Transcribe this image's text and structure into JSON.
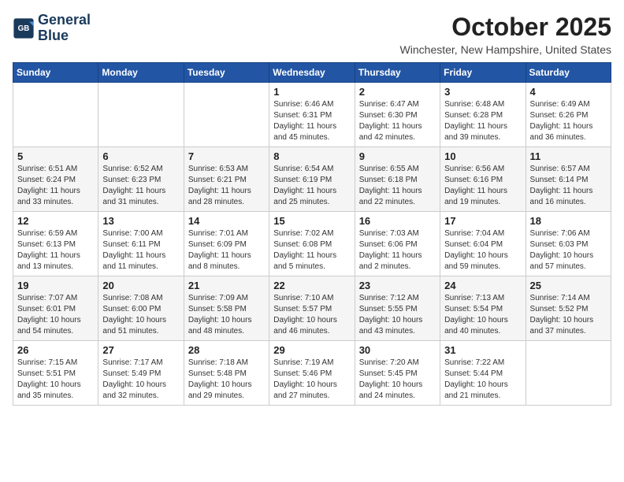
{
  "header": {
    "logo_line1": "General",
    "logo_line2": "Blue",
    "month_title": "October 2025",
    "location": "Winchester, New Hampshire, United States"
  },
  "days_of_week": [
    "Sunday",
    "Monday",
    "Tuesday",
    "Wednesday",
    "Thursday",
    "Friday",
    "Saturday"
  ],
  "weeks": [
    [
      {
        "day": "",
        "info": ""
      },
      {
        "day": "",
        "info": ""
      },
      {
        "day": "",
        "info": ""
      },
      {
        "day": "1",
        "info": "Sunrise: 6:46 AM\nSunset: 6:31 PM\nDaylight: 11 hours and 45 minutes."
      },
      {
        "day": "2",
        "info": "Sunrise: 6:47 AM\nSunset: 6:30 PM\nDaylight: 11 hours and 42 minutes."
      },
      {
        "day": "3",
        "info": "Sunrise: 6:48 AM\nSunset: 6:28 PM\nDaylight: 11 hours and 39 minutes."
      },
      {
        "day": "4",
        "info": "Sunrise: 6:49 AM\nSunset: 6:26 PM\nDaylight: 11 hours and 36 minutes."
      }
    ],
    [
      {
        "day": "5",
        "info": "Sunrise: 6:51 AM\nSunset: 6:24 PM\nDaylight: 11 hours and 33 minutes."
      },
      {
        "day": "6",
        "info": "Sunrise: 6:52 AM\nSunset: 6:23 PM\nDaylight: 11 hours and 31 minutes."
      },
      {
        "day": "7",
        "info": "Sunrise: 6:53 AM\nSunset: 6:21 PM\nDaylight: 11 hours and 28 minutes."
      },
      {
        "day": "8",
        "info": "Sunrise: 6:54 AM\nSunset: 6:19 PM\nDaylight: 11 hours and 25 minutes."
      },
      {
        "day": "9",
        "info": "Sunrise: 6:55 AM\nSunset: 6:18 PM\nDaylight: 11 hours and 22 minutes."
      },
      {
        "day": "10",
        "info": "Sunrise: 6:56 AM\nSunset: 6:16 PM\nDaylight: 11 hours and 19 minutes."
      },
      {
        "day": "11",
        "info": "Sunrise: 6:57 AM\nSunset: 6:14 PM\nDaylight: 11 hours and 16 minutes."
      }
    ],
    [
      {
        "day": "12",
        "info": "Sunrise: 6:59 AM\nSunset: 6:13 PM\nDaylight: 11 hours and 13 minutes."
      },
      {
        "day": "13",
        "info": "Sunrise: 7:00 AM\nSunset: 6:11 PM\nDaylight: 11 hours and 11 minutes."
      },
      {
        "day": "14",
        "info": "Sunrise: 7:01 AM\nSunset: 6:09 PM\nDaylight: 11 hours and 8 minutes."
      },
      {
        "day": "15",
        "info": "Sunrise: 7:02 AM\nSunset: 6:08 PM\nDaylight: 11 hours and 5 minutes."
      },
      {
        "day": "16",
        "info": "Sunrise: 7:03 AM\nSunset: 6:06 PM\nDaylight: 11 hours and 2 minutes."
      },
      {
        "day": "17",
        "info": "Sunrise: 7:04 AM\nSunset: 6:04 PM\nDaylight: 10 hours and 59 minutes."
      },
      {
        "day": "18",
        "info": "Sunrise: 7:06 AM\nSunset: 6:03 PM\nDaylight: 10 hours and 57 minutes."
      }
    ],
    [
      {
        "day": "19",
        "info": "Sunrise: 7:07 AM\nSunset: 6:01 PM\nDaylight: 10 hours and 54 minutes."
      },
      {
        "day": "20",
        "info": "Sunrise: 7:08 AM\nSunset: 6:00 PM\nDaylight: 10 hours and 51 minutes."
      },
      {
        "day": "21",
        "info": "Sunrise: 7:09 AM\nSunset: 5:58 PM\nDaylight: 10 hours and 48 minutes."
      },
      {
        "day": "22",
        "info": "Sunrise: 7:10 AM\nSunset: 5:57 PM\nDaylight: 10 hours and 46 minutes."
      },
      {
        "day": "23",
        "info": "Sunrise: 7:12 AM\nSunset: 5:55 PM\nDaylight: 10 hours and 43 minutes."
      },
      {
        "day": "24",
        "info": "Sunrise: 7:13 AM\nSunset: 5:54 PM\nDaylight: 10 hours and 40 minutes."
      },
      {
        "day": "25",
        "info": "Sunrise: 7:14 AM\nSunset: 5:52 PM\nDaylight: 10 hours and 37 minutes."
      }
    ],
    [
      {
        "day": "26",
        "info": "Sunrise: 7:15 AM\nSunset: 5:51 PM\nDaylight: 10 hours and 35 minutes."
      },
      {
        "day": "27",
        "info": "Sunrise: 7:17 AM\nSunset: 5:49 PM\nDaylight: 10 hours and 32 minutes."
      },
      {
        "day": "28",
        "info": "Sunrise: 7:18 AM\nSunset: 5:48 PM\nDaylight: 10 hours and 29 minutes."
      },
      {
        "day": "29",
        "info": "Sunrise: 7:19 AM\nSunset: 5:46 PM\nDaylight: 10 hours and 27 minutes."
      },
      {
        "day": "30",
        "info": "Sunrise: 7:20 AM\nSunset: 5:45 PM\nDaylight: 10 hours and 24 minutes."
      },
      {
        "day": "31",
        "info": "Sunrise: 7:22 AM\nSunset: 5:44 PM\nDaylight: 10 hours and 21 minutes."
      },
      {
        "day": "",
        "info": ""
      }
    ]
  ]
}
